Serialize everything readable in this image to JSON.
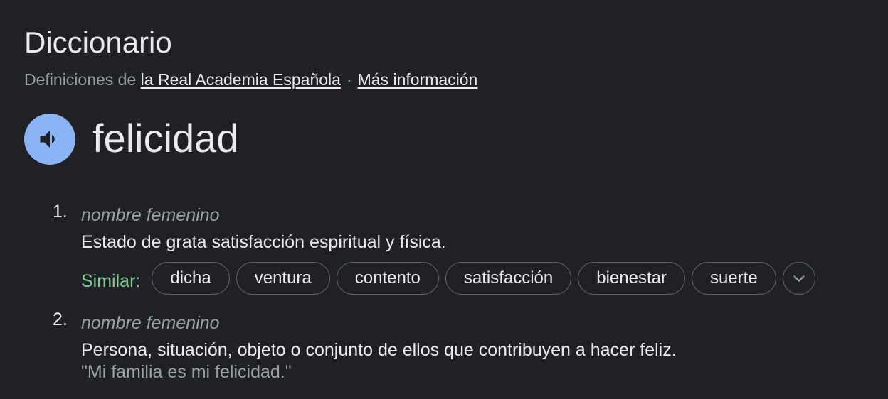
{
  "header": {
    "title": "Diccionario",
    "source_prefix": "Definiciones de",
    "source_link": "la Real Academia Española",
    "separator": "·",
    "more_link": "Más información"
  },
  "entry": {
    "word": "felicidad",
    "speaker_icon": "volume-icon"
  },
  "definitions": [
    {
      "number": "1.",
      "part_of_speech": "nombre femenino",
      "text": "Estado de grata satisfacción espiritual y física.",
      "similar_label": "Similar:",
      "similar": [
        "dicha",
        "ventura",
        "contento",
        "satisfacción",
        "bienestar",
        "suerte"
      ],
      "expand_icon": "chevron-down-icon"
    },
    {
      "number": "2.",
      "part_of_speech": "nombre femenino",
      "text": "Persona, situación, objeto o conjunto de ellos que contribuyen a hacer feliz.",
      "example": "\"Mi familia es mi felicidad.\""
    }
  ],
  "colors": {
    "background": "#202124",
    "accent": "#8ab4f8",
    "similar_label": "#81c995",
    "text": "#e8eaed",
    "muted": "#9aa0a6"
  }
}
